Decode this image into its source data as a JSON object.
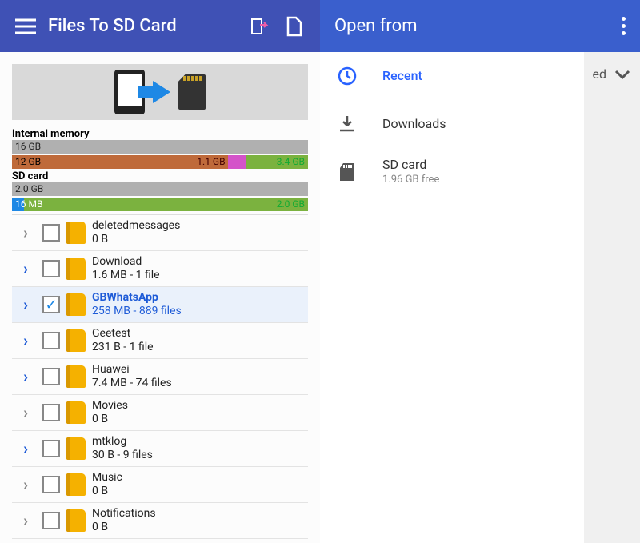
{
  "left": {
    "title": "Files To SD Card",
    "internal": {
      "label": "Internal memory",
      "total": "16 GB",
      "used": "12 GB",
      "other": "1.1 GB",
      "free": "3.4 GB"
    },
    "sdcard": {
      "label": "SD card",
      "total": "2.0 GB",
      "used": "16 MB",
      "free": "2.0 GB"
    },
    "folders": [
      {
        "expanded": false,
        "checked": false,
        "name": "deletedmessages",
        "sub": "0 B"
      },
      {
        "expanded": true,
        "checked": false,
        "name": "Download",
        "sub": "1.6 MB - 1 file"
      },
      {
        "expanded": true,
        "checked": true,
        "name": "GBWhatsApp",
        "sub": "258 MB - 889 files",
        "selected": true
      },
      {
        "expanded": true,
        "checked": false,
        "name": "Geetest",
        "sub": "231 B - 1 file"
      },
      {
        "expanded": true,
        "checked": false,
        "name": "Huawei",
        "sub": "7.4 MB - 74 files"
      },
      {
        "expanded": false,
        "checked": false,
        "name": "Movies",
        "sub": "0 B"
      },
      {
        "expanded": true,
        "checked": false,
        "name": "mtklog",
        "sub": "30 B - 9 files"
      },
      {
        "expanded": false,
        "checked": false,
        "name": "Music",
        "sub": "0 B"
      },
      {
        "expanded": false,
        "checked": false,
        "name": "Notifications",
        "sub": "0 B"
      }
    ]
  },
  "right": {
    "title": "Open from",
    "items": [
      {
        "icon": "clock",
        "title": "Recent",
        "sub": "",
        "active": true
      },
      {
        "icon": "download",
        "title": "Downloads",
        "sub": ""
      },
      {
        "icon": "sdcard",
        "title": "SD card",
        "sub": "1.96 GB free"
      }
    ],
    "behind_text": "ed"
  }
}
